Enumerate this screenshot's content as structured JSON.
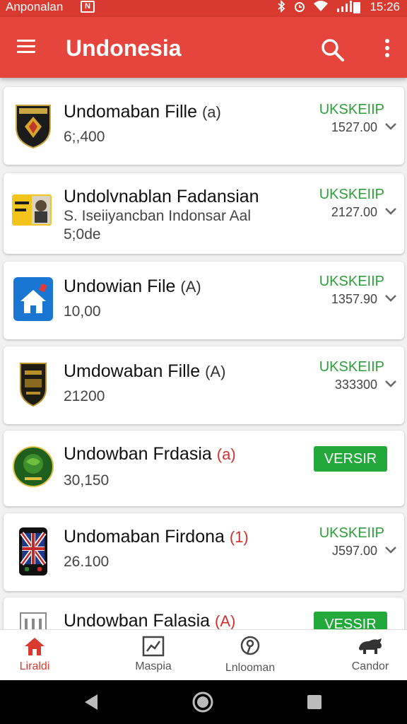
{
  "status_bar": {
    "carrier": "Anponalan",
    "notification": "N",
    "clock": "15:26"
  },
  "app_bar": {
    "title": "Undonesia"
  },
  "items": [
    {
      "name": "Undomaban Fille",
      "badge": "(a)",
      "sub": "6;,400",
      "status": "UKSKEIIP",
      "price": "1527.00"
    },
    {
      "name": "Undolvnablan Fadansian",
      "sub": "S. Iseiiyancban Indonsar Aal",
      "sub2": "5;0de",
      "status": "UKSKEIIP",
      "price": "2127.00"
    },
    {
      "name": "Undowian File",
      "badge": "(A)",
      "sub": "10,00",
      "status": "UKSKEIIP",
      "price": "1357.90"
    },
    {
      "name": "Umdowaban Fille",
      "badge": "(A)",
      "sub": "21200",
      "status": "UKSKEIIP",
      "price": "333300"
    },
    {
      "name": "Undowban Frdasia",
      "badge": "(a)",
      "sub": "30,150",
      "button": "VERSIR"
    },
    {
      "name": "Undomaban Firdona",
      "badge": "(1)",
      "sub": "26.100",
      "status": "UKSKEIIP",
      "price": "J597.00"
    },
    {
      "name": "Undowban Falasia",
      "badge": "(A)",
      "button": "VESSIR"
    }
  ],
  "bottom_nav": [
    {
      "label": "Liraldi",
      "icon": "home-icon",
      "active": true
    },
    {
      "label": "Maspia",
      "icon": "chart-icon"
    },
    {
      "label": "Lnlooman",
      "icon": "search-location-icon"
    },
    {
      "label": "Candor",
      "icon": "animal-icon"
    }
  ],
  "colors": {
    "primary": "#e5453c",
    "status_bar": "#d93a30",
    "success": "#2e9e3a",
    "button": "#22a83b"
  }
}
